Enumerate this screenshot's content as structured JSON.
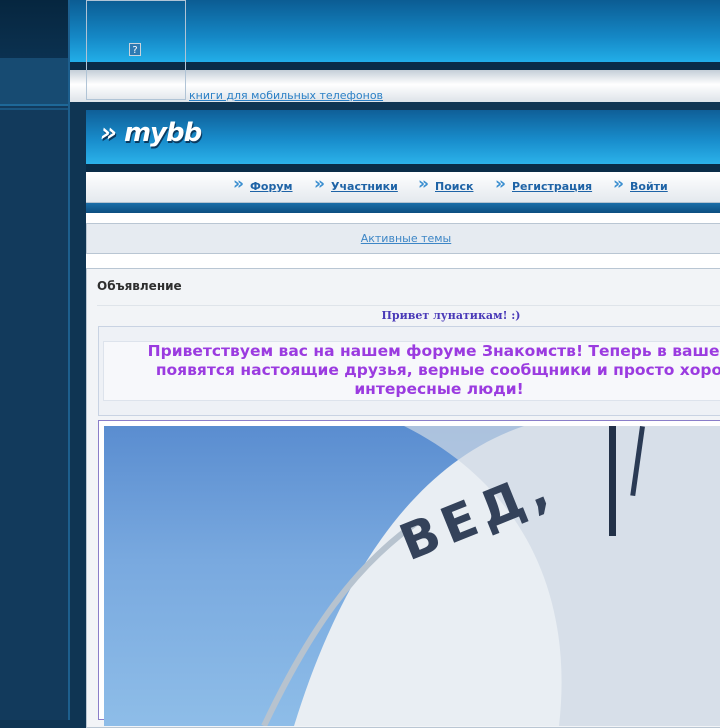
{
  "page": {
    "broken_image_glyph": "?"
  },
  "ad": {
    "link_text": "книги для мобильных телефонов"
  },
  "header": {
    "logo_text": "» mybb"
  },
  "nav": {
    "items": [
      {
        "label": "Форум"
      },
      {
        "label": "Участники"
      },
      {
        "label": "Поиск"
      },
      {
        "label": "Регистрация"
      },
      {
        "label": "Войти"
      }
    ]
  },
  "active_topics": {
    "link_text": "Активные темы"
  },
  "announcement": {
    "title": "Объявление",
    "greeting": "Привет лунатикам! :)",
    "welcome_lines": [
      "Приветствуем вас на нашем форуме Знакомств! Теперь в вашей",
      "появятся настоящие друзья, верные сообщники и просто хоро",
      "интересные люди!"
    ]
  },
  "colors": {
    "header_blue": "#188ccb",
    "nav_link": "#1e63a6",
    "welcome_purple": "#9b3be0",
    "greeting_blue": "#4a3ab8"
  }
}
